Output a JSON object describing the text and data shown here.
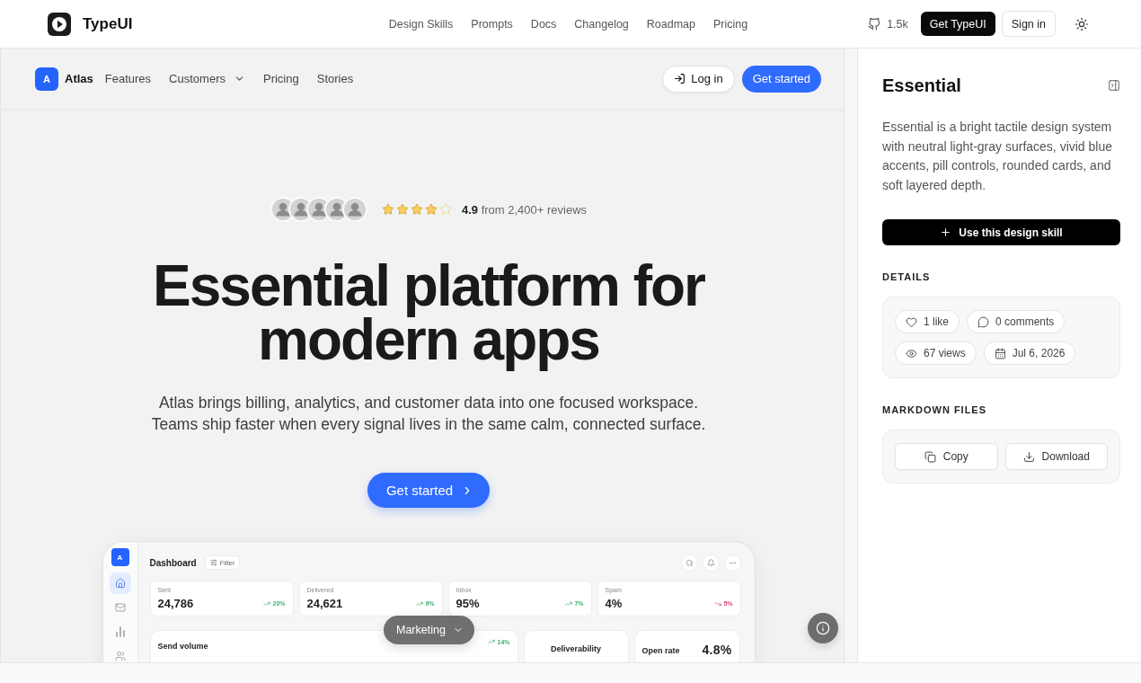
{
  "top_bar": {
    "logo": "TypeUI",
    "nav": [
      "Design Skills",
      "Prompts",
      "Docs",
      "Changelog",
      "Roadmap",
      "Pricing"
    ],
    "github_stars": "1.5k",
    "get_button": "Get TypeUI",
    "sign_in": "Sign in"
  },
  "preview": {
    "nav": {
      "logo_letter": "A",
      "brand": "Atlas",
      "links": [
        {
          "label": "Features",
          "has_menu": false
        },
        {
          "label": "Customers",
          "has_menu": true
        },
        {
          "label": "Pricing",
          "has_menu": false
        },
        {
          "label": "Stories",
          "has_menu": false
        }
      ],
      "log_in": "Log in",
      "get_started": "Get started"
    },
    "hero": {
      "stars": 4,
      "rating": "**4.9** from 2,400+ reviews",
      "title": "Essential platform for modern apps",
      "subtitle": "Atlas brings billing, analytics, and customer data into one focused workspace. Teams ship faster when every signal lives in the same calm, connected surface.",
      "cta": "Get started"
    },
    "dashboard": {
      "logo_letter": "A",
      "sidebar": [
        {
          "kind": "home",
          "selected": true
        },
        {
          "kind": "mail",
          "selected": false
        },
        {
          "kind": "chart",
          "selected": false
        },
        {
          "kind": "users",
          "selected": false
        }
      ],
      "title": "Dashboard",
      "filter": "Filter",
      "stats": [
        {
          "label": "Sent",
          "value": "24,786",
          "change": "20%",
          "rising": true
        },
        {
          "label": "Delivered",
          "value": "24,621",
          "change": "9%",
          "rising": true
        },
        {
          "label": "Inbox",
          "value": "95%",
          "change": "7%",
          "rising": true
        },
        {
          "label": "Spam",
          "value": "4%",
          "change": "5%",
          "rising": false
        }
      ],
      "panels": [
        {
          "kind": "trend",
          "title": "Send volume",
          "change": "14%",
          "rising": true
        },
        {
          "kind": "title",
          "title": "Deliverability"
        },
        {
          "kind": "figure",
          "title": "Open rate",
          "value": "4.8%"
        }
      ]
    },
    "segment_menu": "Marketing"
  },
  "detail_panel": {
    "title": "Essential",
    "description": "Essential is a bright tactile design system with neutral light-gray surfaces, vivid blue accents, pill controls, rounded cards, and soft layered depth.",
    "use_button": "Use this design skill",
    "details_heading": "DETAILS",
    "details": [
      {
        "kind": "likes",
        "text": "1 like"
      },
      {
        "kind": "comments",
        "text": "0 comments"
      },
      {
        "kind": "views",
        "text": "67 views"
      },
      {
        "kind": "date",
        "text": "Jul 6, 2026"
      }
    ],
    "files_heading": "MARKDOWN FILES",
    "file_actions": [
      {
        "kind": "copy",
        "label": "Copy"
      },
      {
        "kind": "download",
        "label": "Download"
      }
    ]
  }
}
